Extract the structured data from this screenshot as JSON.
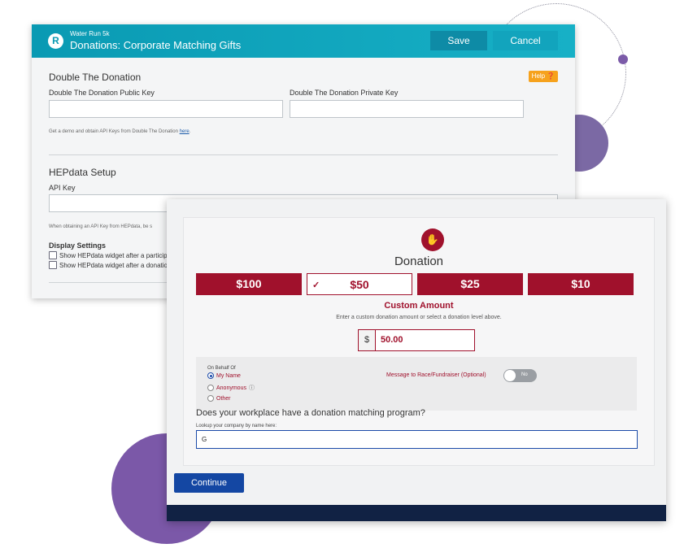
{
  "back_panel": {
    "event_name": "Water Run 5k",
    "title": "Donations: Corporate Matching Gifts",
    "logo_letter": "R",
    "save_label": "Save",
    "cancel_label": "Cancel",
    "help_label": "Help ❓",
    "dtd": {
      "section_title": "Double The Donation",
      "public_key_label": "Double The Donation Public Key",
      "private_key_label": "Double The Donation Private Key",
      "hint_text": "Get a demo and obtain API Keys from Double The Donation ",
      "hint_link": "here",
      "hint_end": "."
    },
    "hep": {
      "section_title": "HEPdata Setup",
      "api_key_label": "API Key",
      "hint_text": "When obtaining an API Key from HEPdata, be s",
      "display_settings_label": "Display Settings",
      "checkbox_1": "Show HEPdata widget after a participa",
      "checkbox_2": "Show HEPdata widget after a donation"
    }
  },
  "front_panel": {
    "title": "Donation",
    "amounts": [
      "$100",
      "$50",
      "$25",
      "$10"
    ],
    "selected_amount": "$50",
    "check_mark": "✓",
    "custom_title": "Custom Amount",
    "custom_hint": "Enter a custom donation amount or select a donation level above.",
    "currency_symbol": "$",
    "amount_value": "50.00",
    "on_behalf_label": "On Behalf Of",
    "on_behalf_options": [
      "My Name",
      "Anonymous",
      "Other"
    ],
    "message_label": "Message to Race/Fundraiser (Optional)",
    "toggle_label": "No",
    "match_question": "Does your workplace have a donation matching program?",
    "match_hint": "Lookup your company by name here:",
    "match_input_value": "G",
    "continue_label": "Continue"
  },
  "colors": {
    "brand_teal": "#0a9ab3",
    "donation_red": "#a0112c",
    "primary_blue": "#1447a3",
    "help_orange": "#f6a21d"
  }
}
